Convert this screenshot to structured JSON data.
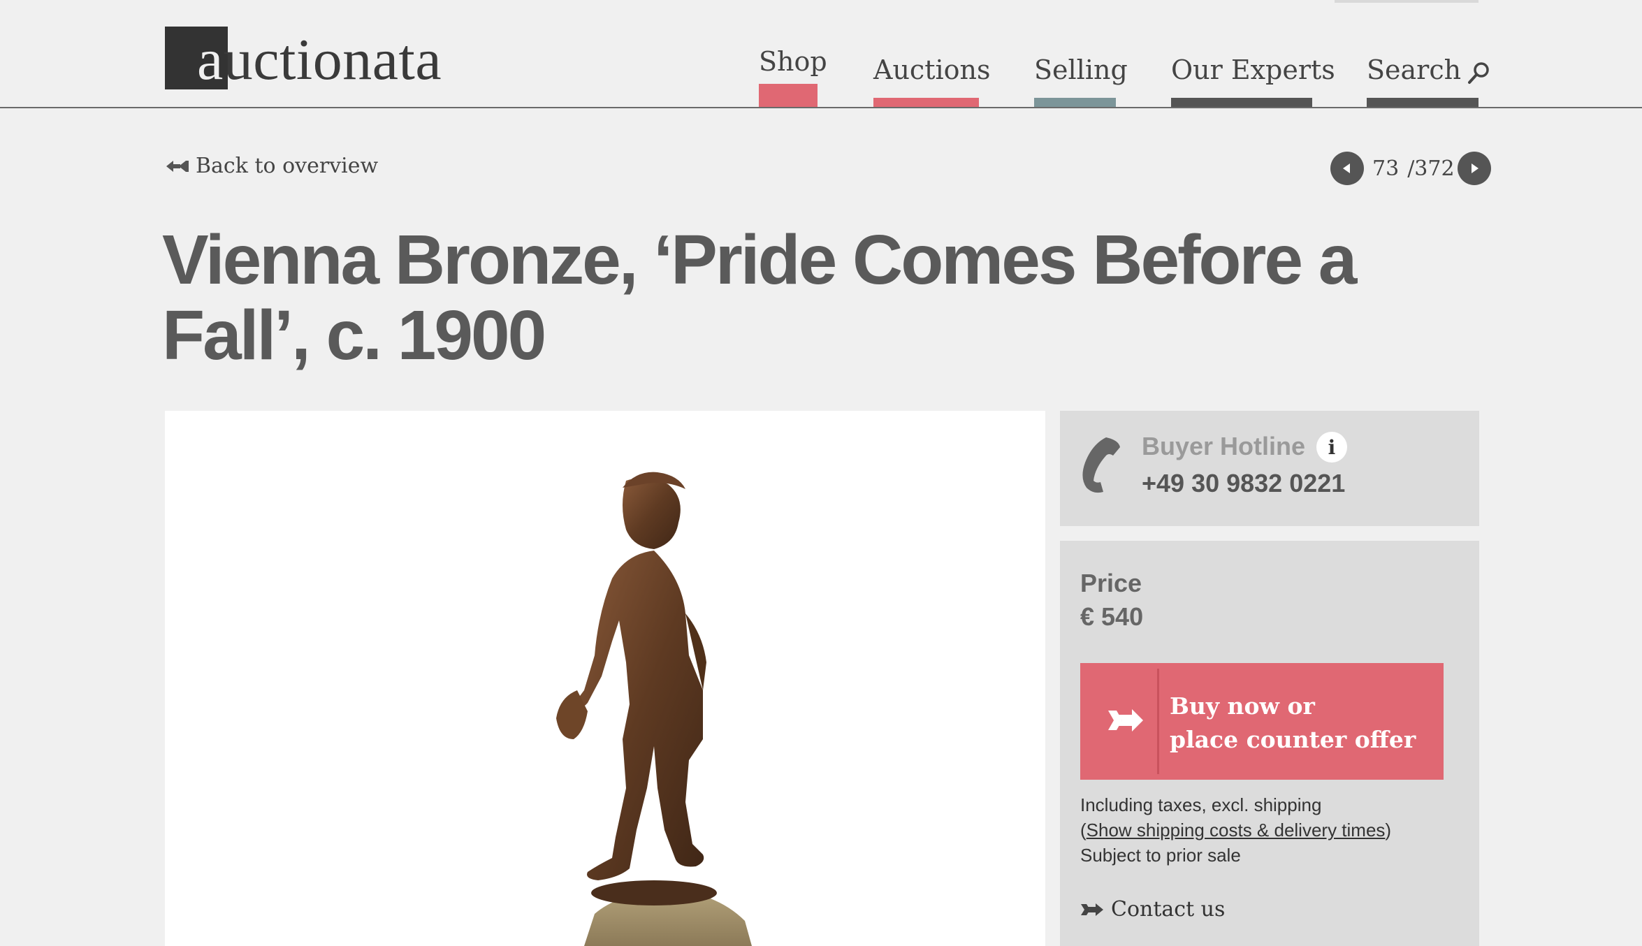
{
  "header": {
    "logo_text_first": "a",
    "logo_text_rest": "uctionata",
    "nav": {
      "shop": "Shop",
      "auctions": "Auctions",
      "selling": "Selling",
      "experts": "Our Experts",
      "search": "Search"
    }
  },
  "back_link": "Back to overview",
  "pager": {
    "current": "73",
    "total": "/372"
  },
  "title": "Vienna Bronze, ‘Pride Comes Before a Fall’, c. 1900",
  "hotline": {
    "label": "Buyer Hotline",
    "info": "i",
    "phone": "+49 30 9832 0221"
  },
  "price": {
    "label": "Price",
    "value": "€ 540",
    "button_line1": "Buy now or",
    "button_line2": "place counter offer",
    "note1": "Including taxes, excl. shipping",
    "note2_open": "(",
    "note2_link": "Show shipping costs & delivery times",
    "note2_close": ")",
    "note3": "Subject to prior sale",
    "contact": "Contact us"
  },
  "colors": {
    "accent": "#e06873",
    "selling_bar": "#7c9599",
    "dark_bar": "#555555"
  },
  "icons": [
    "search-icon",
    "back-arrow-icon",
    "prev-arrow-icon",
    "next-arrow-icon",
    "phone-icon",
    "info-icon",
    "buy-arrow-icon",
    "contact-arrow-icon"
  ]
}
